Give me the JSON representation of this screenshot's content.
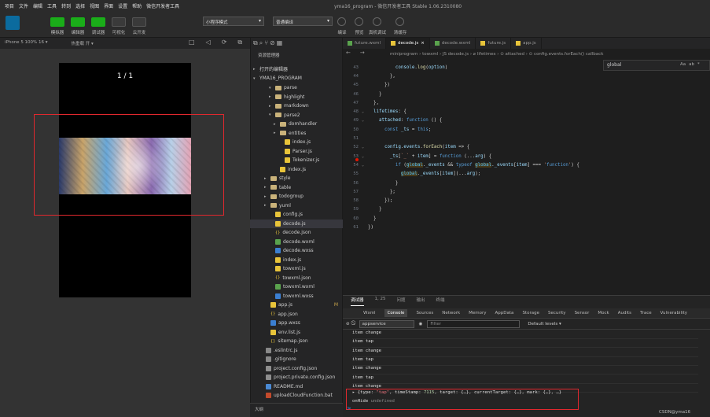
{
  "menubar": {
    "items": [
      "项目",
      "文件",
      "编辑",
      "工具",
      "转到",
      "选择",
      "视图",
      "界面",
      "设置",
      "帮助",
      "微信开发者工具"
    ],
    "title": "yma16_program - 微信开发者工具 Stable 1.06.2310080"
  },
  "toolbar": {
    "mode_buttons": [
      "模拟器",
      "编辑器",
      "调试器",
      "可视化",
      "云开发"
    ],
    "compile_mode": "小程序模式",
    "compile_target": "普通编译",
    "right_buttons": [
      "编译",
      "预览",
      "真机调试",
      "清缓存"
    ]
  },
  "simulator": {
    "device": "iPhone 5 100% 16 ▾",
    "hotreload": "热重载 开 ▾",
    "pager": "1 / 1"
  },
  "explorer": {
    "header": "资源管理器",
    "open_editors": "打开的编辑器",
    "project": "YMA16_PROGRAM",
    "rows": [
      {
        "label": "parse",
        "kind": "folder",
        "arrow": "▾",
        "indent": 24
      },
      {
        "label": "highlight",
        "kind": "folder",
        "arrow": "▸",
        "indent": 24
      },
      {
        "label": "markdown",
        "kind": "folder",
        "arrow": "▸",
        "indent": 24
      },
      {
        "label": "parse2",
        "kind": "folder",
        "arrow": "▾",
        "indent": 24
      },
      {
        "label": "domhandler",
        "kind": "folder",
        "arrow": "▸",
        "indent": 30
      },
      {
        "label": "entities",
        "kind": "folder",
        "arrow": "▸",
        "indent": 30
      },
      {
        "label": "index.js",
        "kind": "js",
        "arrow": "",
        "indent": 36
      },
      {
        "label": "Parser.js",
        "kind": "js",
        "arrow": "",
        "indent": 36
      },
      {
        "label": "Tokenizer.js",
        "kind": "js",
        "arrow": "",
        "indent": 36
      },
      {
        "label": "index.js",
        "kind": "js",
        "arrow": "",
        "indent": 30
      },
      {
        "label": "style",
        "kind": "folder",
        "arrow": "▸",
        "indent": 18
      },
      {
        "label": "table",
        "kind": "folder",
        "arrow": "▸",
        "indent": 18
      },
      {
        "label": "todogroup",
        "kind": "folder",
        "arrow": "▸",
        "indent": 18
      },
      {
        "label": "yuml",
        "kind": "folder",
        "arrow": "▸",
        "indent": 18
      },
      {
        "label": "config.js",
        "kind": "js",
        "arrow": "",
        "indent": 24
      },
      {
        "label": "decode.js",
        "kind": "js",
        "arrow": "",
        "indent": 24,
        "selected": true
      },
      {
        "label": "decode.json",
        "kind": "json",
        "arrow": "",
        "indent": 24
      },
      {
        "label": "decode.wxml",
        "kind": "wxml",
        "arrow": "",
        "indent": 24
      },
      {
        "label": "decode.wxss",
        "kind": "wxss",
        "arrow": "",
        "indent": 24
      },
      {
        "label": "index.js",
        "kind": "js",
        "arrow": "",
        "indent": 24
      },
      {
        "label": "towxml.js",
        "kind": "js",
        "arrow": "",
        "indent": 24
      },
      {
        "label": "towxml.json",
        "kind": "json",
        "arrow": "",
        "indent": 24
      },
      {
        "label": "towxml.wxml",
        "kind": "wxml",
        "arrow": "",
        "indent": 24
      },
      {
        "label": "towxml.wxss",
        "kind": "wxss",
        "arrow": "",
        "indent": 24
      },
      {
        "label": "app.js",
        "kind": "js",
        "arrow": "",
        "indent": 18,
        "badge": "M"
      },
      {
        "label": "app.json",
        "kind": "json",
        "arrow": "",
        "indent": 18
      },
      {
        "label": "app.wxss",
        "kind": "wxss",
        "arrow": "",
        "indent": 18
      },
      {
        "label": "env.list.js",
        "kind": "js",
        "arrow": "",
        "indent": 18
      },
      {
        "label": "sitemap.json",
        "kind": "json",
        "arrow": "",
        "indent": 18
      },
      {
        "label": ".eslintrc.js",
        "kind": "dot",
        "arrow": "",
        "indent": 12
      },
      {
        "label": ".gitignore",
        "kind": "dot",
        "arrow": "",
        "indent": 12
      },
      {
        "label": "project.config.json",
        "kind": "cfg",
        "arrow": "",
        "indent": 12
      },
      {
        "label": "project.private.config.json",
        "kind": "cfg",
        "arrow": "",
        "indent": 12
      },
      {
        "label": "README.md",
        "kind": "md",
        "arrow": "",
        "indent": 12
      },
      {
        "label": "uploadCloudFunction.bat",
        "kind": "bat",
        "arrow": "",
        "indent": 12
      }
    ],
    "outline": "大纲"
  },
  "editor": {
    "tabs": [
      {
        "label": "future.wxml",
        "active": false
      },
      {
        "label": "decode.js",
        "active": true
      },
      {
        "label": "decode.wxml",
        "active": false
      },
      {
        "label": "future.js",
        "active": false
      },
      {
        "label": "app.js",
        "active": false
      }
    ],
    "breadcrumb": "miniprogram › towxml › JS decode.js › ⌀ lifetimes › ⊙ attached › ⊙ config.events.forEach() callback",
    "search_text": "global",
    "search_opts": [
      "Aa",
      "ab",
      "*"
    ],
    "lines": [
      {
        "n": "43",
        "html": "          console.log(option)"
      },
      {
        "n": "44",
        "html": "        },"
      },
      {
        "n": "45",
        "html": "      })"
      },
      {
        "n": "46",
        "html": "    }"
      },
      {
        "n": "47",
        "html": "  },"
      },
      {
        "n": "48",
        "html": "  lifetimes: {"
      },
      {
        "n": "49",
        "html": "    attached: function () {"
      },
      {
        "n": "50",
        "html": "      const _ts = this;"
      },
      {
        "n": "51",
        "html": ""
      },
      {
        "n": "52",
        "html": "      config.events.forEach(item => {"
      },
      {
        "n": "53",
        "html": "        _ts[`_` + item] = function (...arg) {"
      },
      {
        "n": "54",
        "html": "          if (global._events && typeof global._events[item] === 'function') {"
      },
      {
        "n": "55",
        "html": "            global._events[item](...arg);"
      },
      {
        "n": "56",
        "html": "          }"
      },
      {
        "n": "57",
        "html": "        };"
      },
      {
        "n": "58",
        "html": "      });"
      },
      {
        "n": "59",
        "html": "    }"
      },
      {
        "n": "60",
        "html": "  }"
      },
      {
        "n": "61",
        "html": "})"
      }
    ]
  },
  "console": {
    "panel_tabs": [
      "调试器",
      "1, 25",
      "问题",
      "输出",
      "终端"
    ],
    "tabs": [
      "Wxml",
      "Console",
      "Sources",
      "Network",
      "Memory",
      "AppData",
      "Storage",
      "Security",
      "Sensor",
      "Mock",
      "Audits",
      "Trace",
      "Vulnerability"
    ],
    "context": "appservice",
    "filter_placeholder": "Filter",
    "levels": "Default levels ▾",
    "logs": [
      "item change",
      "item tap",
      "item change",
      "item tap",
      "item change",
      "item tap",
      "item change"
    ],
    "object_line_prefix": "▸ {type: ",
    "object_type": "\"tap\"",
    "object_mid": ", timeStamp: ",
    "object_ts": "7115",
    "object_rest": ", target: {…}, currentTarget: {…}, mark: {…}, …}",
    "onhide_label": "onHide",
    "onhide_value": "undefined",
    "prompt": ">"
  },
  "watermark": "CSDN@yma16",
  "colors": {
    "accent_green": "#1aad19",
    "highlight_red": "#e0282e",
    "breakpoint": "#e51400"
  }
}
